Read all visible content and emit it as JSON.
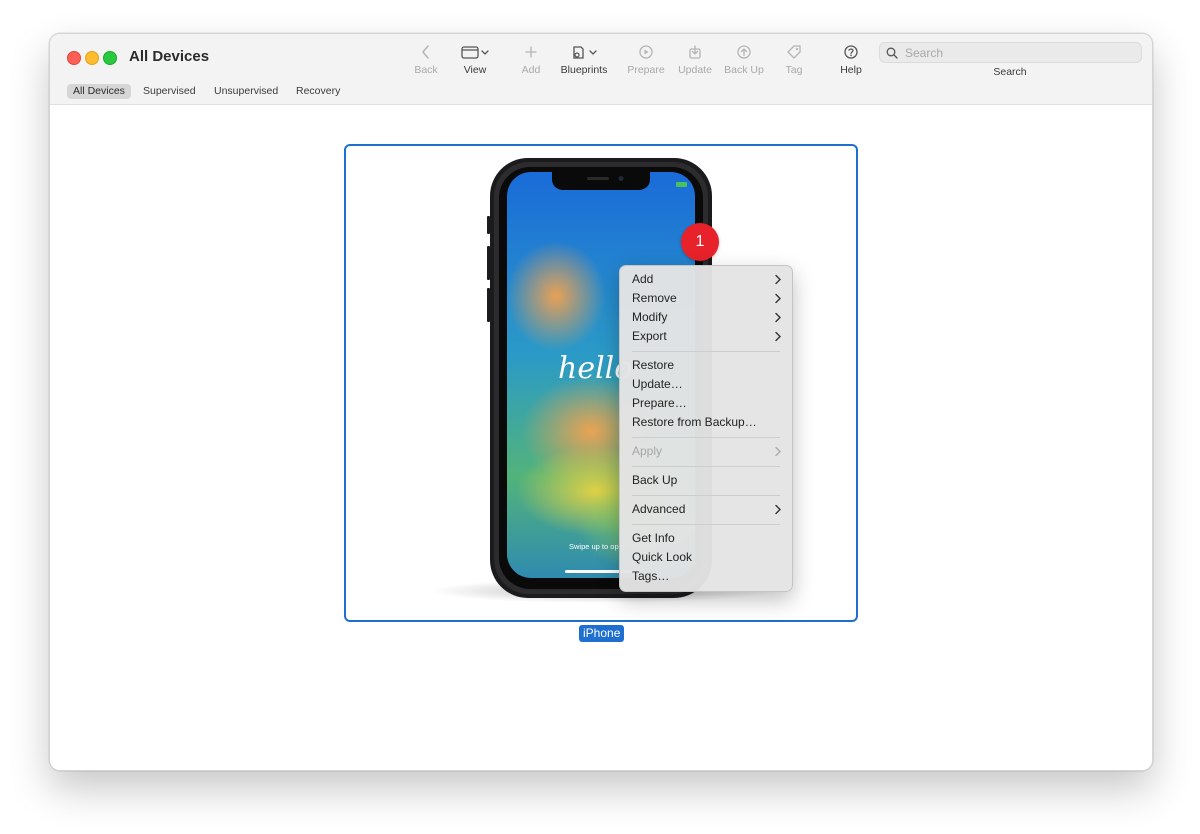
{
  "window": {
    "title": "All Devices"
  },
  "toolbar": {
    "back": {
      "label": "Back",
      "icon": "chevron-left-icon",
      "enabled": false
    },
    "view": {
      "label": "View",
      "icon": "window-layout-icon",
      "enabled": true
    },
    "add": {
      "label": "Add",
      "icon": "plus-icon",
      "enabled": false
    },
    "blueprints": {
      "label": "Blueprints",
      "icon": "blueprint-icon",
      "enabled": true
    },
    "prepare": {
      "label": "Prepare",
      "icon": "prepare-icon",
      "enabled": false
    },
    "update": {
      "label": "Update",
      "icon": "update-icon",
      "enabled": false
    },
    "backup": {
      "label": "Back Up",
      "icon": "backup-icon",
      "enabled": false
    },
    "tag": {
      "label": "Tag",
      "icon": "tag-icon",
      "enabled": false
    },
    "help": {
      "label": "Help",
      "icon": "help-icon",
      "enabled": true
    }
  },
  "search": {
    "placeholder": "Search",
    "label": "Search",
    "value": ""
  },
  "filters": [
    {
      "label": "All Devices",
      "selected": true
    },
    {
      "label": "Supervised",
      "selected": false
    },
    {
      "label": "Unsupervised",
      "selected": false
    },
    {
      "label": "Recovery",
      "selected": false
    }
  ],
  "device": {
    "name": "iPhone",
    "badge_count": "1",
    "screen_text": "hello",
    "swipe_text": "Swipe up to open"
  },
  "context_menu": {
    "items": [
      {
        "label": "Add",
        "submenu": true,
        "enabled": true
      },
      {
        "label": "Remove",
        "submenu": true,
        "enabled": true
      },
      {
        "label": "Modify",
        "submenu": true,
        "enabled": true
      },
      {
        "label": "Export",
        "submenu": true,
        "enabled": true
      },
      {
        "label": "Restore",
        "submenu": false,
        "enabled": true
      },
      {
        "label": "Update…",
        "submenu": false,
        "enabled": true
      },
      {
        "label": "Prepare…",
        "submenu": false,
        "enabled": true
      },
      {
        "label": "Restore from Backup…",
        "submenu": false,
        "enabled": true
      },
      {
        "label": "Apply",
        "submenu": true,
        "enabled": false
      },
      {
        "label": "Back Up",
        "submenu": false,
        "enabled": true
      },
      {
        "label": "Advanced",
        "submenu": true,
        "enabled": true
      },
      {
        "label": "Get Info",
        "submenu": false,
        "enabled": true
      },
      {
        "label": "Quick Look",
        "submenu": false,
        "enabled": true
      },
      {
        "label": "Tags…",
        "submenu": false,
        "enabled": true
      }
    ]
  },
  "colors": {
    "accent": "#1f6fd0",
    "badge": "#e8222a",
    "close": "#fe5f57",
    "minimize": "#febc2e",
    "zoom": "#28c840"
  }
}
